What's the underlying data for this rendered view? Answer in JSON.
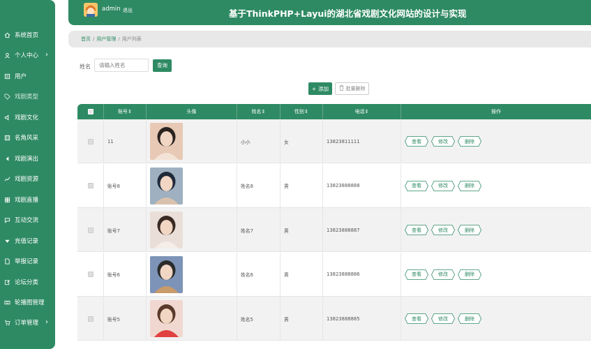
{
  "sidebar": {
    "items": [
      {
        "label": "系统首页",
        "icon": "home-icon",
        "arrow": ""
      },
      {
        "label": "个人中心",
        "icon": "user-icon",
        "arrow": "›"
      },
      {
        "label": "用户",
        "icon": "list-icon",
        "arrow": ""
      },
      {
        "label": "戏剧类型",
        "icon": "tag-icon",
        "arrow": ""
      },
      {
        "label": "戏剧文化",
        "icon": "speaker-icon",
        "arrow": ""
      },
      {
        "label": "名角风采",
        "icon": "film-icon",
        "arrow": ""
      },
      {
        "label": "戏剧演出",
        "icon": "caret-left-icon",
        "arrow": ""
      },
      {
        "label": "戏剧资源",
        "icon": "chart-icon",
        "arrow": ""
      },
      {
        "label": "戏剧直播",
        "icon": "grid-icon",
        "arrow": ""
      },
      {
        "label": "互动交流",
        "icon": "chat-icon",
        "arrow": ""
      },
      {
        "label": "充值记录",
        "icon": "caret-down-icon",
        "arrow": ""
      },
      {
        "label": "举报记录",
        "icon": "document-icon",
        "arrow": ""
      },
      {
        "label": "论坛分类",
        "icon": "edit-icon",
        "arrow": ""
      },
      {
        "label": "轮播图管理",
        "icon": "keyboard-icon",
        "arrow": ""
      },
      {
        "label": "订单管理",
        "icon": "cart-icon",
        "arrow": "›"
      }
    ]
  },
  "header": {
    "admin": "admin",
    "logout": "退出",
    "title": "基于ThinkPHP+Layui的湖北省戏剧文化网站的设计与实现"
  },
  "breadcrumb": {
    "home": "首页",
    "section": "用户管理",
    "current": "用户列表"
  },
  "search": {
    "label": "姓名",
    "placeholder": "请输入姓名",
    "button": "查询"
  },
  "actions": {
    "add": "添加",
    "batch_delete": "批量删除"
  },
  "table": {
    "headers": {
      "account": "账号",
      "avatar": "头像",
      "name": "姓名",
      "gender": "性别",
      "phone": "电话",
      "ops": "操作"
    },
    "ops": {
      "view": "查看",
      "edit": "修改",
      "delete": "删除"
    },
    "rows": [
      {
        "account": "11",
        "name": "小小",
        "gender": "女",
        "phone": "13823811111"
      },
      {
        "account": "账号8",
        "name": "姓名8",
        "gender": "男",
        "phone": "13823888888"
      },
      {
        "account": "账号7",
        "name": "姓名7",
        "gender": "男",
        "phone": "13823888887"
      },
      {
        "account": "账号6",
        "name": "姓名6",
        "gender": "男",
        "phone": "13823888886"
      },
      {
        "account": "账号5",
        "name": "姓名5",
        "gender": "男",
        "phone": "13823888885"
      }
    ]
  },
  "colors": {
    "primary": "#2e8a63",
    "breadcrumb_bg": "#e8e8e8"
  }
}
